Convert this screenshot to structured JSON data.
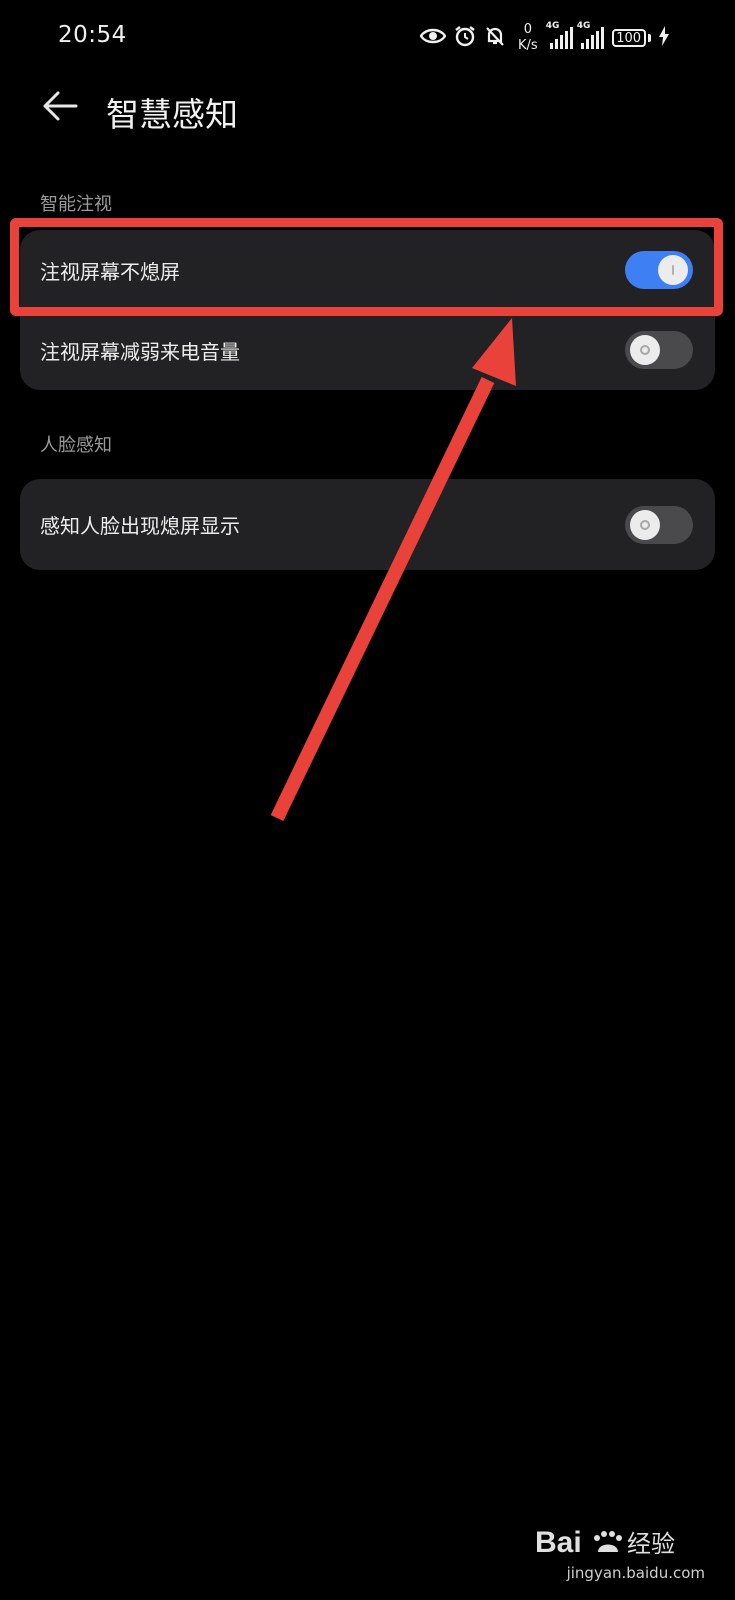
{
  "status_bar": {
    "time": "20:54",
    "net_speed_value": "0",
    "net_speed_unit": "K/s",
    "signal1_label": "4G",
    "signal2_label": "4G",
    "battery": "100",
    "icons": [
      "eye-icon",
      "alarm-icon",
      "bell-muted-icon",
      "signal-icon",
      "signal-icon",
      "battery-icon",
      "charging-icon"
    ]
  },
  "header": {
    "title": "智慧感知",
    "back_icon": "arrow-left-icon"
  },
  "sections": [
    {
      "label": "智能注视",
      "rows": [
        {
          "label": "注视屏幕不熄屏",
          "enabled": true
        },
        {
          "label": "注视屏幕减弱来电音量",
          "enabled": false
        }
      ]
    },
    {
      "label": "人脸感知",
      "rows": [
        {
          "label": "感知人脸出现熄屏显示",
          "enabled": false
        }
      ]
    }
  ],
  "annotation": {
    "color": "#e8423a"
  },
  "watermark": {
    "text": "jingyan.baidu.com",
    "logo_text": "Bai",
    "logo_suffix": "经验"
  },
  "colors": {
    "background": "#000000",
    "card": "#222224",
    "accent": "#3f7ff4"
  }
}
